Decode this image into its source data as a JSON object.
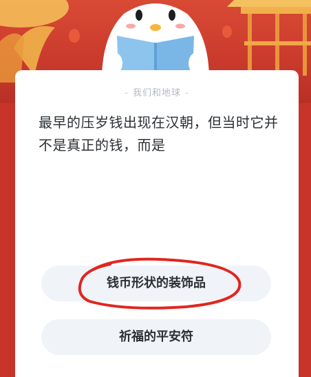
{
  "quiz": {
    "category": "我们和地球",
    "category_dash_left": "-",
    "category_dash_right": "-",
    "question": "最早的压岁钱出现在汉朝，但当时它并不是真正的钱，而是",
    "answers": [
      {
        "label": "钱币形状的装饰品"
      },
      {
        "label": "祈福的平安符"
      }
    ]
  },
  "colors": {
    "banner_red": "#c9342a",
    "answer_bg": "#f0f3f7",
    "highlight_circle": "#e0261f"
  }
}
